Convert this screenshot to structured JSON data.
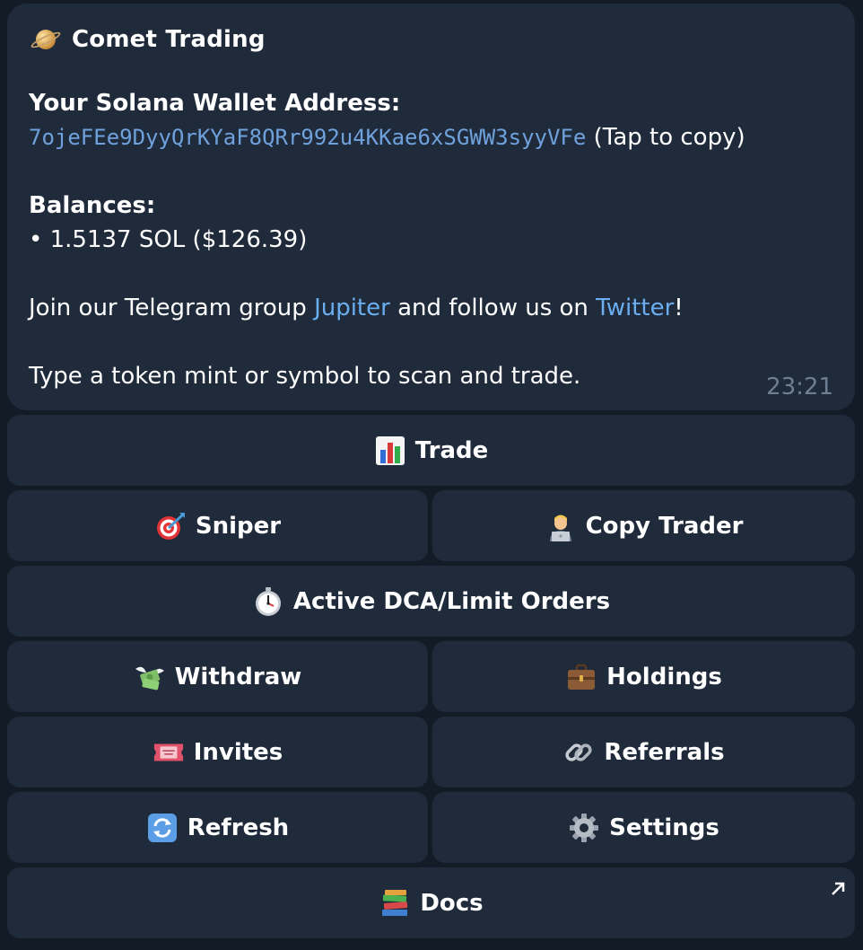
{
  "message": {
    "title": "Comet Trading",
    "wallet_label": "Your Solana Wallet Address:",
    "wallet_address": "7ojeFEe9DyyQrKYaF8QRr992u4KKae6xSGWW3syyVFe",
    "copy_hint": "(Tap to copy)",
    "balances_label": "Balances:",
    "balance_line": "• 1.5137 SOL ($126.39)",
    "join_prefix": "Join our Telegram group ",
    "jupiter_link": "Jupiter",
    "join_middle": " and follow us on ",
    "twitter_link": "Twitter",
    "join_suffix": "!",
    "instruction": "Type a token mint or symbol to scan and trade.",
    "time": "23:21"
  },
  "buttons": {
    "trade": "Trade",
    "sniper": "Sniper",
    "copy_trader": "Copy Trader",
    "active_orders": "Active DCA/Limit Orders",
    "withdraw": "Withdraw",
    "holdings": "Holdings",
    "invites": "Invites",
    "referrals": "Referrals",
    "refresh": "Refresh",
    "settings": "Settings",
    "docs": "Docs"
  },
  "icons": {
    "title": "planet-icon",
    "trade": "bar-chart-icon",
    "sniper": "target-icon",
    "copy_trader": "technologist-icon",
    "active_orders": "stopwatch-icon",
    "withdraw": "money-wings-icon",
    "holdings": "briefcase-icon",
    "invites": "ticket-icon",
    "referrals": "link-icon",
    "refresh": "refresh-icon",
    "settings": "gear-icon",
    "docs": "books-icon",
    "docs_corner": "external-arrow-icon"
  },
  "colors": {
    "background": "#131b26",
    "bubble": "#1f2a3a",
    "address": "#6fa2dc",
    "link": "#6aaeef",
    "timestamp": "#6f7f93"
  }
}
